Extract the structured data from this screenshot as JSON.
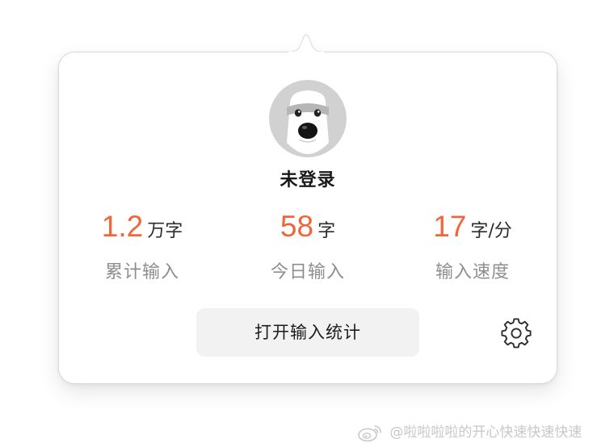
{
  "user": {
    "status": "未登录",
    "avatar": "dog-mascot-avatar"
  },
  "stats": {
    "total": {
      "value": "1.2",
      "unit": "万字",
      "label": "累计输入"
    },
    "today": {
      "value": "58",
      "unit": "字",
      "label": "今日输入"
    },
    "speed": {
      "value": "17",
      "unit": "字/分",
      "label": "输入速度"
    }
  },
  "actions": {
    "open_stats_label": "打开输入统计",
    "settings_icon": "gear-icon"
  },
  "watermark": {
    "text": "@啦啦啦啦的开心快速快速快速",
    "logo": "weibo-logo"
  },
  "colors": {
    "accent": "#f0663a",
    "label": "#8e8e8e",
    "button_bg": "#f2f2f2",
    "avatar_bg": "#d1d1d1"
  }
}
